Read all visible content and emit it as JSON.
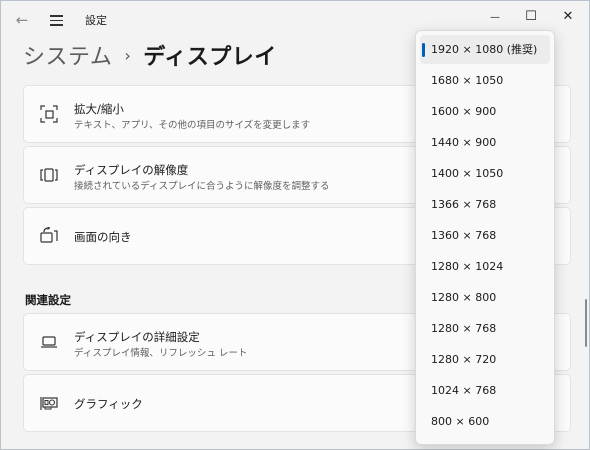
{
  "titlebar": {
    "app_title": "設定",
    "minimize_glyph": "—",
    "maximize_glyph": "☐",
    "close_glyph": "✕",
    "back_glyph": "←"
  },
  "breadcrumb": {
    "root": "システム",
    "separator": "›",
    "current": "ディスプレイ"
  },
  "cards": [
    {
      "title": "拡大/縮小",
      "description": "テキスト、アプリ、その他の項目のサイズを変更します",
      "icon": "scale-icon"
    },
    {
      "title": "ディスプレイの解像度",
      "description": "接続されているディスプレイに合うように解像度を調整する",
      "icon": "resolution-icon"
    },
    {
      "title": "画面の向き",
      "description": "",
      "icon": "orientation-icon"
    }
  ],
  "related": {
    "section_title": "関連設定",
    "items": [
      {
        "title": "ディスプレイの詳細設定",
        "description": "ディスプレイ情報、リフレッシュ レート",
        "icon": "monitor-icon"
      },
      {
        "title": "グラフィック",
        "description": "",
        "icon": "graphics-card-icon"
      }
    ]
  },
  "resolution_dropdown": {
    "selected_index": 0,
    "options": [
      "1920 × 1080 (推奨)",
      "1680 × 1050",
      "1600 × 900",
      "1440 × 900",
      "1400 × 1050",
      "1366 × 768",
      "1360 × 768",
      "1280 × 1024",
      "1280 × 800",
      "1280 × 768",
      "1280 × 720",
      "1024 × 768",
      "800 × 600"
    ]
  },
  "colors": {
    "accent": "#005fb8",
    "background": "#f3f3f3",
    "card": "#fbfbfb"
  }
}
